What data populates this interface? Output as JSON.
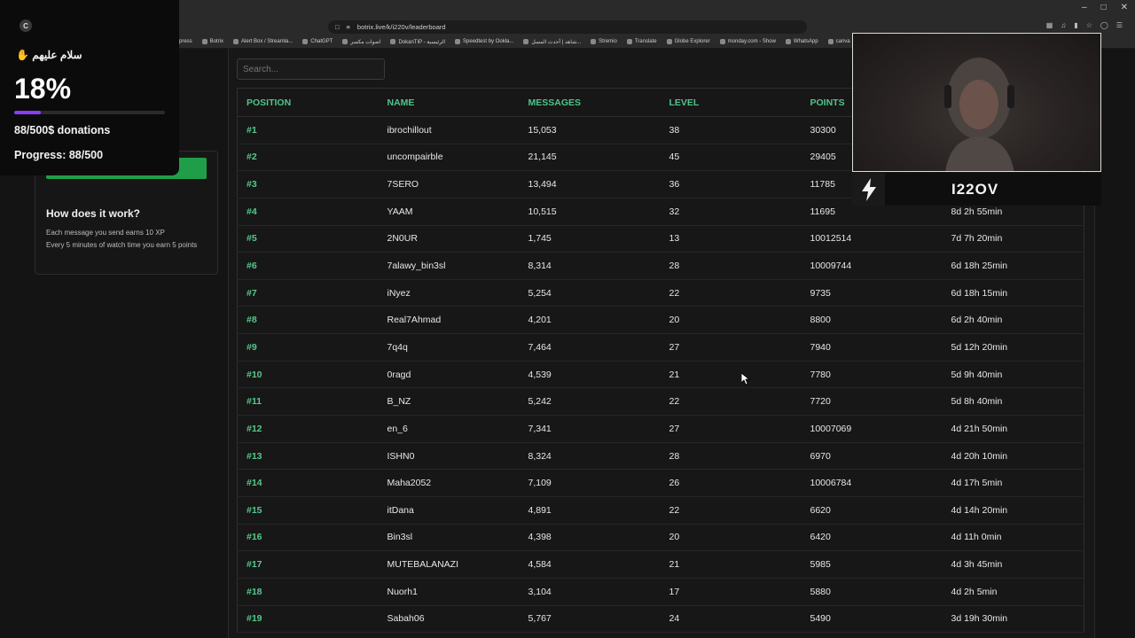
{
  "browser": {
    "url": "botrix.live/k/i220v/leaderboard",
    "bookmarks": [
      "press",
      "Botrix",
      "Alert Box / Streamla...",
      "ChatGPT",
      "اصوات مكسر",
      "DokanTIP - الرئيسية",
      "Speedtest by Ookla...",
      "شاهد | أحدث المسل...",
      "Stremio",
      "Translate",
      "Globe Explorer",
      "monday.com - Show",
      "WhatsApp",
      "canva"
    ]
  },
  "donation": {
    "greeting": "سلام عليهم",
    "greeting_icon": "waving-hand-icon",
    "percent": "18%",
    "progress_fraction": 0.176,
    "amount_text": "88/500$ donations",
    "progress_text": "Progress: 88/500",
    "accent": "#8b3dff"
  },
  "side": {
    "how_title": "How does it work?",
    "how_line1": "Each message you send earns 10 XP",
    "how_line2": "Every 5 minutes of watch time you earn 5 points",
    "button_color": "#1f9e4a"
  },
  "search": {
    "placeholder": "Search..."
  },
  "table": {
    "headers": [
      "POSITION",
      "NAME",
      "MESSAGES",
      "LEVEL",
      "POINTS",
      ""
    ],
    "rows": [
      [
        "#1",
        "ibrochillout",
        "15,053",
        "38",
        "30300",
        ""
      ],
      [
        "#2",
        "uncompairble",
        "21,145",
        "45",
        "29405",
        ""
      ],
      [
        "#3",
        "7SERO",
        "13,494",
        "36",
        "11785",
        ""
      ],
      [
        "#4",
        "YAAM",
        "10,515",
        "32",
        "11695",
        "8d 2h 55min"
      ],
      [
        "#5",
        "2N0UR",
        "1,745",
        "13",
        "10012514",
        "7d 7h 20min"
      ],
      [
        "#6",
        "7alawy_bin3sl",
        "8,314",
        "28",
        "10009744",
        "6d 18h 25min"
      ],
      [
        "#7",
        "iNyez",
        "5,254",
        "22",
        "9735",
        "6d 18h 15min"
      ],
      [
        "#8",
        "Real7Ahmad",
        "4,201",
        "20",
        "8800",
        "6d 2h 40min"
      ],
      [
        "#9",
        "7q4q",
        "7,464",
        "27",
        "7940",
        "5d 12h 20min"
      ],
      [
        "#10",
        "0ragd",
        "4,539",
        "21",
        "7780",
        "5d 9h 40min"
      ],
      [
        "#11",
        "B_NZ",
        "5,242",
        "22",
        "7720",
        "5d 8h 40min"
      ],
      [
        "#12",
        "en_6",
        "7,341",
        "27",
        "10007069",
        "4d 21h 50min"
      ],
      [
        "#13",
        "ISHN0",
        "8,324",
        "28",
        "6970",
        "4d 20h 10min"
      ],
      [
        "#14",
        "Maha2052",
        "7,109",
        "26",
        "10006784",
        "4d 17h 5min"
      ],
      [
        "#15",
        "itDana",
        "4,891",
        "22",
        "6620",
        "4d 14h 20min"
      ],
      [
        "#16",
        "Bin3sl",
        "4,398",
        "20",
        "6420",
        "4d 11h 0min"
      ],
      [
        "#17",
        "MUTEBALANAZI",
        "4,584",
        "21",
        "5985",
        "4d 3h 45min"
      ],
      [
        "#18",
        "Nuorh1",
        "3,104",
        "17",
        "5880",
        "4d 2h 5min"
      ],
      [
        "#19",
        "Sabah06",
        "5,767",
        "24",
        "5490",
        "3d 19h 30min"
      ]
    ],
    "accent": "#4fc48a"
  },
  "stream": {
    "name": "I22OV"
  }
}
